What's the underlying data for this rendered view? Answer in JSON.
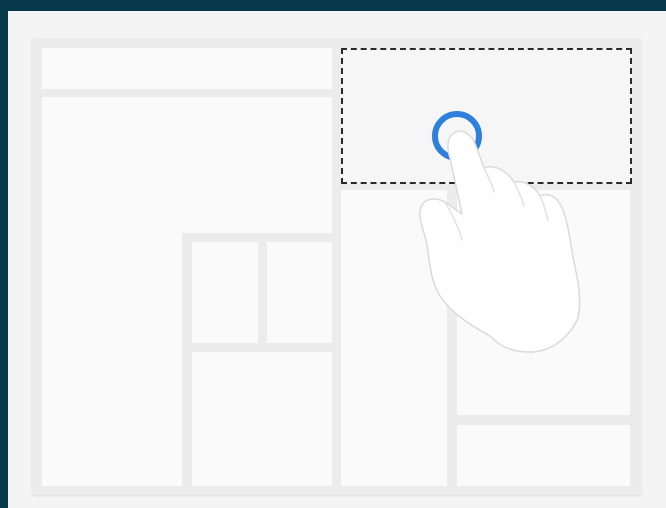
{
  "colors": {
    "frame": "#063a4a",
    "page": "#f4f4f4",
    "board": "#ececec",
    "tile": "#fafafa",
    "selection_border": "#2a2a2a",
    "touch_ring": "#2f7fdc"
  },
  "icons": {
    "gesture": "tap-hand-icon",
    "touch_point": "touch-ring-icon"
  }
}
